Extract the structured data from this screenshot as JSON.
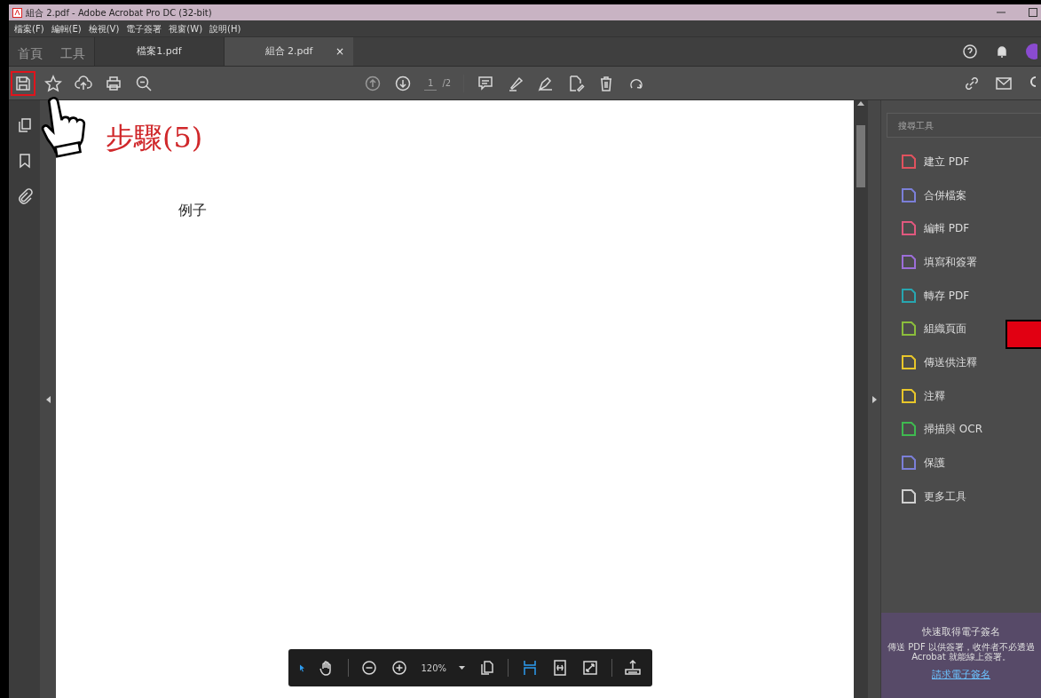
{
  "window": {
    "title": "組合 2.pdf - Adobe Acrobat Pro DC (32-bit)"
  },
  "menu": [
    "檔案(F)",
    "編輯(E)",
    "檢視(V)",
    "電子簽署",
    "視窗(W)",
    "說明(H)"
  ],
  "nav_tabs": [
    "首頁",
    "工具"
  ],
  "doc_tabs": [
    {
      "label": "檔案1.pdf",
      "selected": false
    },
    {
      "label": "組合 2.pdf",
      "selected": true,
      "close": "×"
    }
  ],
  "page_nav": {
    "current": "1",
    "total": "/2"
  },
  "document": {
    "text": "例子"
  },
  "annotation": {
    "label": "步驟(5)"
  },
  "tools_pane": {
    "search_placeholder": "搜尋工具",
    "tools": [
      {
        "label": "建立 PDF",
        "color": "#e0525e"
      },
      {
        "label": "合併檔案",
        "color": "#7b7fd8"
      },
      {
        "label": "編輯 PDF",
        "color": "#e0587e"
      },
      {
        "label": "填寫和簽署",
        "color": "#9c6ed8"
      },
      {
        "label": "轉存 PDF",
        "color": "#27a6b0"
      },
      {
        "label": "組織頁面",
        "color": "#8bbd3c"
      },
      {
        "label": "傳送供注釋",
        "color": "#e8c62a"
      },
      {
        "label": "注釋",
        "color": "#e8c62a"
      },
      {
        "label": "掃描與 OCR",
        "color": "#3fb950"
      },
      {
        "label": "保護",
        "color": "#7b7fd8"
      },
      {
        "label": "更多工具",
        "color": "#d0d0d0"
      }
    ],
    "promo": {
      "title": "快速取得電子簽名",
      "body": "傳送 PDF 以供簽署，收件者不必透過 Acrobat 就能線上簽署。",
      "link": "請求電子簽名"
    }
  },
  "zoom_toolbar": {
    "zoom": "120%"
  }
}
